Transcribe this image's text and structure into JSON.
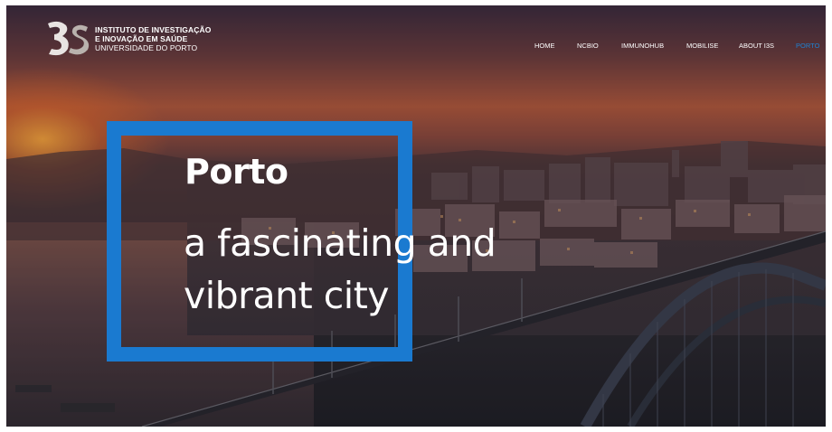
{
  "logo": {
    "mark": "i3S",
    "line1": "INSTITUTO DE INVESTIGAÇÃO",
    "line2": "E INOVAÇÃO EM SAÚDE",
    "line3": "UNIVERSIDADE DO PORTO"
  },
  "nav": {
    "items": [
      {
        "label": "HOME",
        "active": false
      },
      {
        "label": "NCBIO",
        "active": false
      },
      {
        "label": "IMMUNOHUB",
        "active": false
      },
      {
        "label": "MOBILISE",
        "active": false
      },
      {
        "label": "ABOUT I3S",
        "active": false
      },
      {
        "label": "PORTO",
        "active": true
      }
    ],
    "active_color": "#1e82d2"
  },
  "hero": {
    "title": "Porto",
    "subtitle_line1": "a fascinating and",
    "subtitle_line2": "vibrant city",
    "frame_color": "#1a7ad0"
  }
}
